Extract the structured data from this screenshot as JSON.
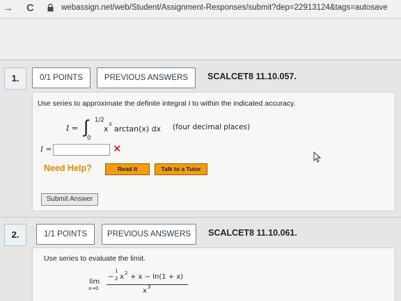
{
  "browser": {
    "back_glyph": "→",
    "reload_glyph": "C",
    "url": "webassign.net/web/Student/Assignment-Responses/submit?dep=22913124&tags=autosave"
  },
  "q1": {
    "number": "1.",
    "points": "0/1 POINTS",
    "prev_label": "PREVIOUS ANSWERS",
    "code": "SCALCET8 11.10.057.",
    "prompt": "Use series to approximate the definite integral I to within the indicated accuracy.",
    "integral_lhs": "I =",
    "upper_limit": "1/2",
    "lower_limit": "0",
    "integrand_base": "x",
    "integrand_exp": "3",
    "integrand_rest": "arctan(x) dx",
    "accuracy": "(four decimal places)",
    "answer_label": "I =",
    "answer_value": "",
    "wrong_mark": "✕",
    "need_help": "Need Help?",
    "read_it": "Read It",
    "talk_tutor": "Talk to a Tutor",
    "submit": "Submit Answer"
  },
  "q2": {
    "number": "2.",
    "points": "1/1 POINTS",
    "prev_label": "PREVIOUS ANSWERS",
    "code": "SCALCET8 11.10.061.",
    "prompt": "Use series to evaluate the limit.",
    "lim": "lim",
    "lim_sub": "x→0",
    "num_sign": "−",
    "num_frac_num": "1",
    "num_frac_den": "2",
    "num_x": "x",
    "num_exp": "2",
    "num_rest": "+ x − ln(1 + x)",
    "den_base": "x",
    "den_exp": "3"
  }
}
